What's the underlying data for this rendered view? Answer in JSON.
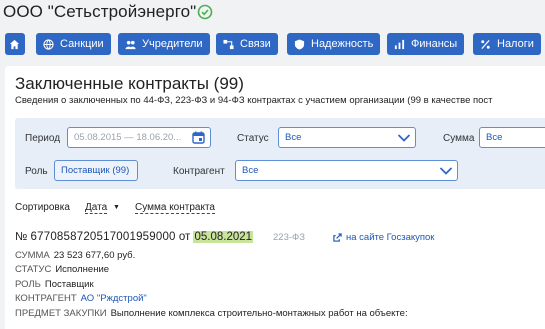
{
  "company": {
    "title": "ООО \"Сетьстройэнерго\""
  },
  "nav": {
    "home": "",
    "sanctions": "Санкции",
    "founders": "Учредители",
    "links": "Связи",
    "reliability": "Надежность",
    "finance": "Финансы",
    "taxes": "Налоги"
  },
  "section": {
    "title": "Заключенные контракты (99)",
    "subtitle": "Сведения о заключенных по 44-ФЗ, 223-ФЗ и 94-ФЗ контрактах с участием организации (99 в качестве пост"
  },
  "filters": {
    "period_label": "Период",
    "period_value": "05.08.2015 — 18.06.20...",
    "status_label": "Статус",
    "status_value": "Все",
    "amount_label": "Сумма",
    "amount_value": "Все",
    "role_label": "Роль",
    "role_value": "Поставщик (99)",
    "counterparty_label": "Контрагент",
    "counterparty_value": "Все"
  },
  "sort": {
    "label": "Сортировка",
    "by_date": "Дата",
    "by_amount": "Сумма контракта"
  },
  "contract": {
    "number_prefix": "№",
    "number": "6770858720517001959000",
    "from": "от",
    "date": "05.08.2021",
    "law": "223-ФЗ",
    "link": "на сайте Госзакупок",
    "amount_label": "СУММА",
    "amount": "23 523 677,60 руб.",
    "status_label": "СТАТУС",
    "status": "Исполнение",
    "role_label": "РОЛЬ",
    "role": "Поставщик",
    "counterparty_label": "КОНТРАГЕНТ",
    "counterparty": "АО \"Рждстрой\"",
    "subject_label": "ПРЕДМЕТ ЗАКУПКИ",
    "subject": "Выполнение комплекса строительно-монтажных работ на объекте:"
  },
  "colors": {
    "accent": "#2f67c5",
    "link": "#1d57b8",
    "highlight": "#c8e39a",
    "verified": "#4caf50"
  },
  "icons": [
    "check-circle-icon",
    "home-icon",
    "globe-icon",
    "users-icon",
    "link-icon",
    "shield-icon",
    "chart-icon",
    "percent-icon",
    "calendar-icon",
    "chevron-down-icon",
    "external-link-icon"
  ]
}
